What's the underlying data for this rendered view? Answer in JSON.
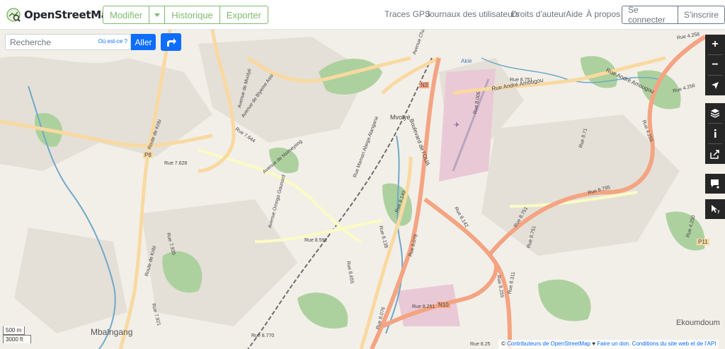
{
  "header": {
    "brand_name": "OpenStreetMap",
    "edit_buttons": {
      "modifier": "Modifier",
      "historique": "Historique",
      "exporter": "Exporter"
    },
    "nav_links": [
      "Traces GPS",
      "Journaux des utilisateurs",
      "Droits d'auteur",
      "Aide",
      "À propos"
    ],
    "user_buttons": {
      "login": "Se connecter",
      "signup": "S'inscrire"
    }
  },
  "search": {
    "placeholder": "Recherche",
    "where_link": "Où est-ce ?",
    "go_label": "Aller"
  },
  "map_controls": {
    "zoom_in": "+",
    "zoom_out": "−"
  },
  "scale": {
    "metric": "500 m",
    "imperial": "3000 ft"
  },
  "attribution": {
    "prefix": "© ",
    "contributors": "Contributeurs de OpenStreetMap",
    "heart": " ♥ ",
    "donate": "Faire un don.",
    "terms": " Conditions du site web et de l'API"
  },
  "map_labels": {
    "mvolye": "Mvolyé",
    "mbalngang": "Mbalngang",
    "ekoumdoum": "Ekoumdoum",
    "rue_andre_amougou": "Rue André Amougou",
    "rue_andre_amougou_2": "Rue André Amougou",
    "boulevard_oua": "Boulevard de l'OUA",
    "avenue_charles_atangana": "Avenue Charles Atangana",
    "avenue_mvolye": "Avenue de Mvolyé",
    "avenue_biyeme_assi": "Avenue de Biyeme Assi",
    "avenue_nsimeyong": "Avenue de Nsimeyong",
    "avenue_omnga_gaunard": "Avenue Omnga Gaunard",
    "route_kribi": "Route de Kribi",
    "route_kribi_2": "Route de Kribi",
    "rue_mama_abega": "Rue Maman Abega Atangana",
    "rue_7628": "Rue 7.628",
    "rue_7644": "Rue 7.644",
    "rue_8592": "Rue 8.592",
    "rue_8655": "Rue 8.655",
    "rue_8770": "Rue 8.770",
    "rue_8138": "Rue 8.138",
    "rue_8140": "Rue 8.140",
    "rue_8076": "Rue 8.076",
    "rue_8078": "Rue 8.078",
    "rue_8251": "Rue 8.251",
    "rue_8142": "Rue 8.142",
    "rue_8751": "Rue 8.751",
    "rue_8795": "Rue 8.795",
    "rue_8795b": "Rue 8.795",
    "rue_8255": "Rue 8.255",
    "rue_8311": "Rue 8.311",
    "rue_8005": "Rue 8.005",
    "rue_4256": "Rue 4.256",
    "rue_4258": "Rue 4.258",
    "rue_4255": "Rue 4.255",
    "rue_4250": "Rue 4.250",
    "rue_8751b": "Rue 8.751",
    "rue_8711": "Rue 8.71",
    "rue_8751c": "Rue 8.751",
    "rue_7935": "Rue 7.935",
    "rue_7921": "Rue 7.921",
    "n3": "N3",
    "n10": "N10",
    "p8": "P8",
    "p11": "P11",
    "akie": "Akié",
    "rue_8829": "Rue 8.25"
  },
  "colors": {
    "brand_green": "#7ebc6f",
    "primary_blue": "#0d6efd",
    "map_bg": "#f2efe9",
    "primary_road": "#f4a482",
    "secondary_road": "#f9d9a0",
    "tertiary_road": "#fbfbc4",
    "forest": "#add19e",
    "water": "#6fa8c8",
    "railway": "#6d6d6d"
  }
}
